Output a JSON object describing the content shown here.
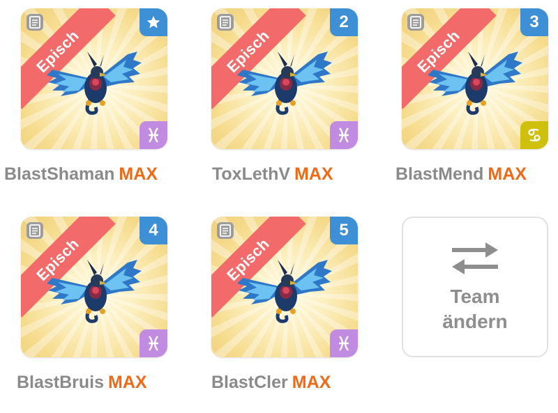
{
  "rarity_label": "Episch",
  "max_label": "MAX",
  "colors": {
    "ribbon": "#f26a6a",
    "badge": "#3d8fd6",
    "pisces": "#c08be0",
    "cancer": "#cfc00e",
    "max": "#f06a16"
  },
  "cards": [
    {
      "name": "BlastShaman",
      "badge_icon": "star-icon",
      "zodiac": "pisces-icon"
    },
    {
      "name": "ToxLethV",
      "badge": "2",
      "zodiac": "pisces-icon"
    },
    {
      "name": "BlastMend",
      "badge": "3",
      "zodiac": "cancer-icon"
    },
    {
      "name": "BlastBruis",
      "badge": "4",
      "zodiac": "pisces-icon"
    },
    {
      "name": "BlastCler",
      "badge": "5",
      "zodiac": "pisces-icon"
    }
  ],
  "team_button": {
    "line1": "Team",
    "line2": "ändern",
    "icon": "swap-arrows-icon"
  }
}
